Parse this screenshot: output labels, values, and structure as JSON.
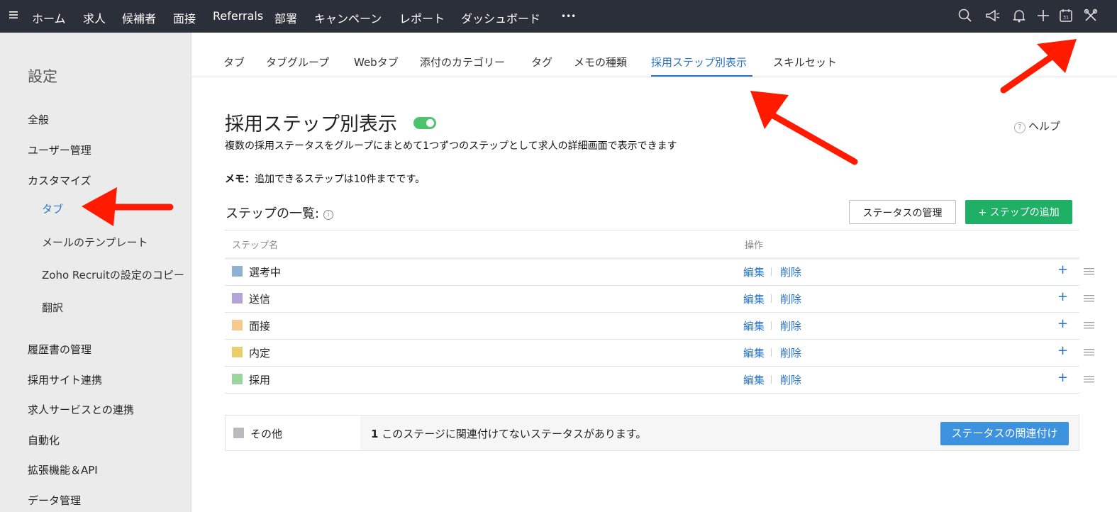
{
  "topbar": {
    "nav": [
      "ホーム",
      "求人",
      "候補者",
      "面接",
      "Referrals",
      "部署",
      "キャンペーン",
      "レポート",
      "ダッシュボード",
      "•••"
    ],
    "icons": [
      "search-icon",
      "megaphone-icon",
      "bell-icon",
      "plus-icon",
      "calendar-icon",
      "tools-icon"
    ],
    "calendar_day": "31"
  },
  "sidebar": {
    "title": "設定",
    "general": "全般",
    "users": "ユーザー管理",
    "customize": "カスタマイズ",
    "sub": [
      "タブ",
      "メールのテンプレート",
      "Zoho Recruitの設定のコピー",
      "翻訳"
    ],
    "items": [
      "履歴書の管理",
      "採用サイト連携",
      "求人サービスとの連携",
      "自動化",
      "拡張機能＆API",
      "データ管理"
    ]
  },
  "tabs": [
    "タブ",
    "タブグループ",
    "Webタブ",
    "添付のカテゴリー",
    "タグ",
    "メモの種類",
    "採用ステップ別表示",
    "スキルセット"
  ],
  "main": {
    "title": "採用ステップ別表示",
    "help": "ヘルプ",
    "description": "複数の採用ステータスをグループにまとめて1つずつのステップとして求人の詳細画面で表示できます",
    "memo_label": "メモ：",
    "memo_text": "追加できるステップは10件までです。",
    "list_title": "ステップの一覧:",
    "manage_button": "ステータスの管理",
    "add_button": "+ ステップの追加",
    "col_name": "ステップ名",
    "col_actions": "操作",
    "edit": "編集",
    "delete": "削除",
    "steps": [
      {
        "name": "選考中",
        "color": "#8fb0d6"
      },
      {
        "name": "送信",
        "color": "#b3a3d9"
      },
      {
        "name": "面接",
        "color": "#f7c98c"
      },
      {
        "name": "内定",
        "color": "#e8cf6a"
      },
      {
        "name": "採用",
        "color": "#9ad59b"
      }
    ],
    "other_name": "その他",
    "other_count": "1",
    "other_msg": "このステージに関連付けてないステータスがあります。",
    "link_button": "ステータスの関連付け"
  }
}
